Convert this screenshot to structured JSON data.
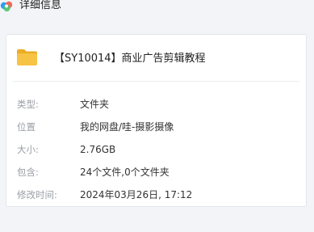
{
  "window": {
    "title": "详细信息",
    "app_icon": "baidu-netdisk-cloud-icon"
  },
  "file": {
    "icon": "folder-icon",
    "name": "【SY10014】商业广告剪辑教程"
  },
  "details": [
    {
      "label": "类型:",
      "value": "文件夹"
    },
    {
      "label": "位置",
      "value": "我的网盘/哇-摄影摄像"
    },
    {
      "label": "大小:",
      "value": "2.76GB"
    },
    {
      "label": "包含:",
      "value": "24个文件,0个文件夹"
    },
    {
      "label": "修改时间:",
      "value": "2024年03月26日, 17:12"
    }
  ],
  "colors": {
    "folder": "#f7c344",
    "folder_dark": "#e9ad27",
    "cloud_blue": "#2f9df4",
    "cloud_red": "#f05a4a",
    "cloud_green": "#4cc46b"
  }
}
